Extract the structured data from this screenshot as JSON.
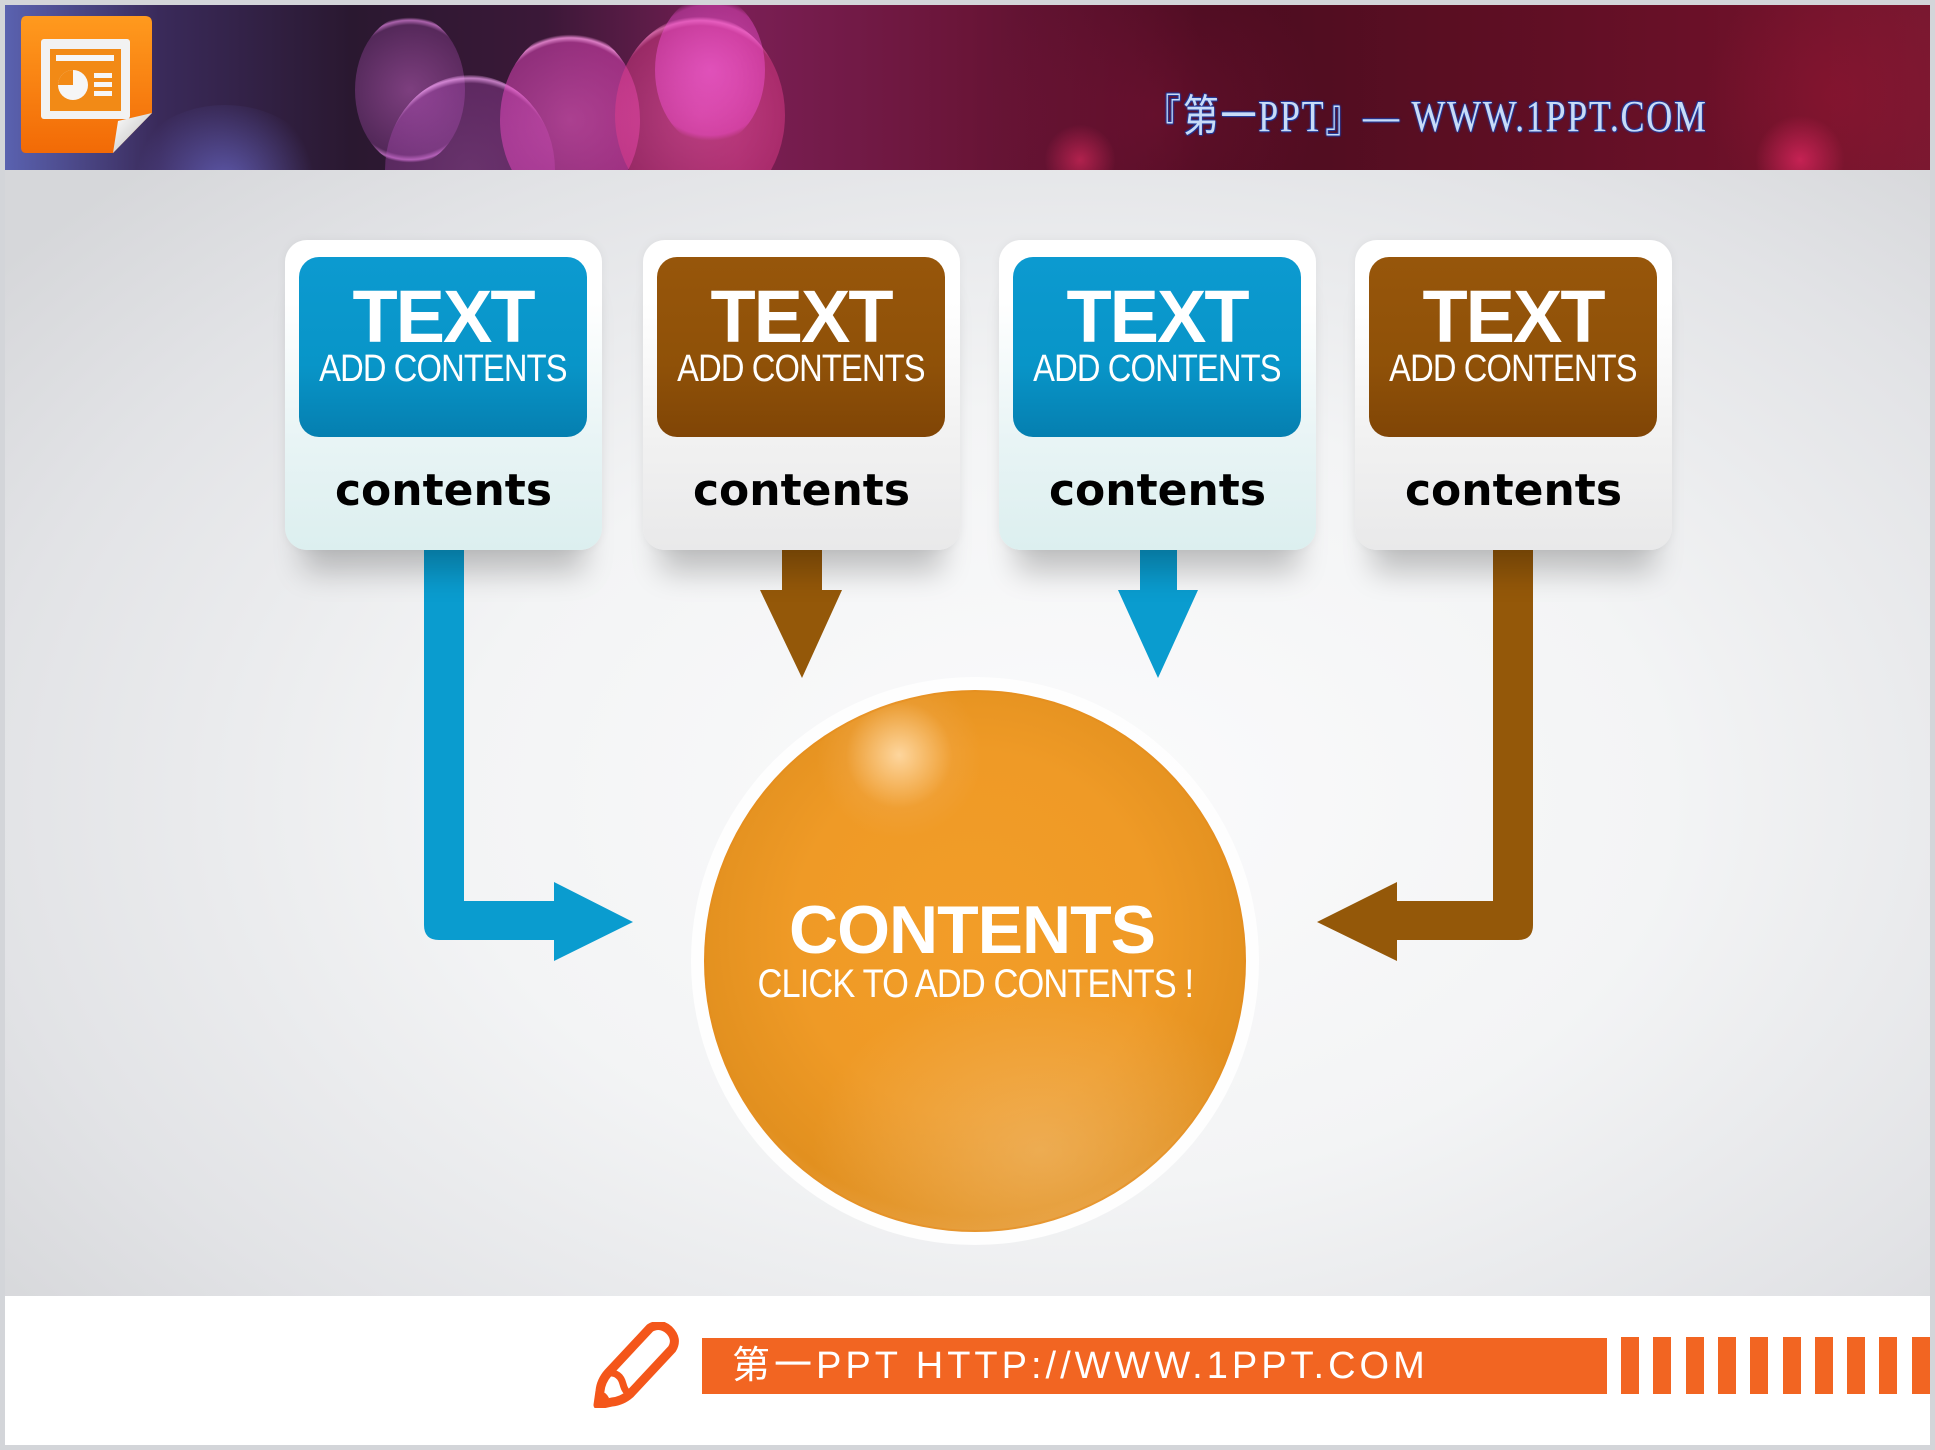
{
  "header": {
    "title": "『第一PPT』— WWW.1PPT.COM",
    "logo_icon": "powerpoint-document-icon"
  },
  "colors": {
    "blue": "#0897cb",
    "brown": "#8e5008",
    "orange": "#f09a27",
    "footer_orange": "#f26522"
  },
  "cards": [
    {
      "title": "TEXT",
      "subtitle": "ADD CONTENTS",
      "label": "contents",
      "color": "blue"
    },
    {
      "title": "TEXT",
      "subtitle": "ADD CONTENTS",
      "label": "contents",
      "color": "brown"
    },
    {
      "title": "TEXT",
      "subtitle": "ADD CONTENTS",
      "label": "contents",
      "color": "blue"
    },
    {
      "title": "TEXT",
      "subtitle": "ADD CONTENTS",
      "label": "contents",
      "color": "brown"
    }
  ],
  "center": {
    "title": "CONTENTS",
    "subtitle": "CLICK TO ADD CONTENTS !"
  },
  "arrows": [
    {
      "from": "card-1",
      "to": "center",
      "shape": "elbow-right",
      "color": "blue"
    },
    {
      "from": "card-2",
      "to": "center",
      "shape": "straight-down",
      "color": "brown"
    },
    {
      "from": "card-3",
      "to": "center",
      "shape": "straight-down",
      "color": "blue"
    },
    {
      "from": "card-4",
      "to": "center",
      "shape": "elbow-left",
      "color": "brown"
    }
  ],
  "footer": {
    "text": "第一PPT HTTP://WWW.1PPT.COM",
    "icon": "pencil-icon",
    "stripe_count": 10
  }
}
